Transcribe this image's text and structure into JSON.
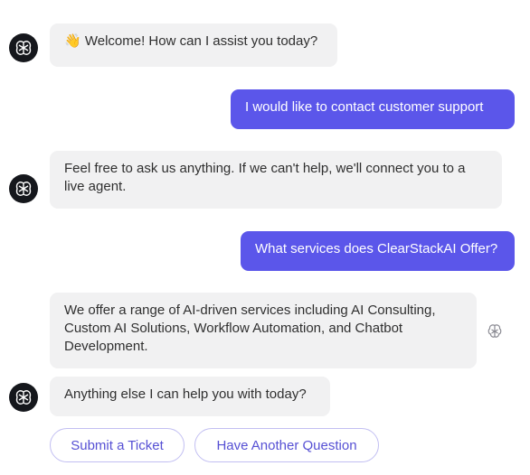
{
  "messages": [
    {
      "from": "bot",
      "emoji": "👋",
      "text": "Welcome! How can I assist you today?"
    },
    {
      "from": "user",
      "text": "I would like to contact customer support"
    },
    {
      "from": "bot",
      "text": "Feel free to ask us anything. If we can't help, we'll connect you to a live agent."
    },
    {
      "from": "user",
      "text": "What services does ClearStackAI Offer?"
    },
    {
      "from": "bot",
      "text": "We offer a range of AI-driven services including AI Consulting, Custom AI Solutions, Workflow Automation, and Chatbot Development."
    },
    {
      "from": "bot",
      "text": "Anything else I can help you with today?"
    }
  ],
  "quick_replies": {
    "submit_ticket": "Submit a Ticket",
    "another_question": "Have Another Question"
  },
  "colors": {
    "user_bubble": "#5b56ea",
    "bot_bubble": "#f1f1f2",
    "avatar": "#15171c",
    "quick_reply_text": "#5650d4"
  }
}
